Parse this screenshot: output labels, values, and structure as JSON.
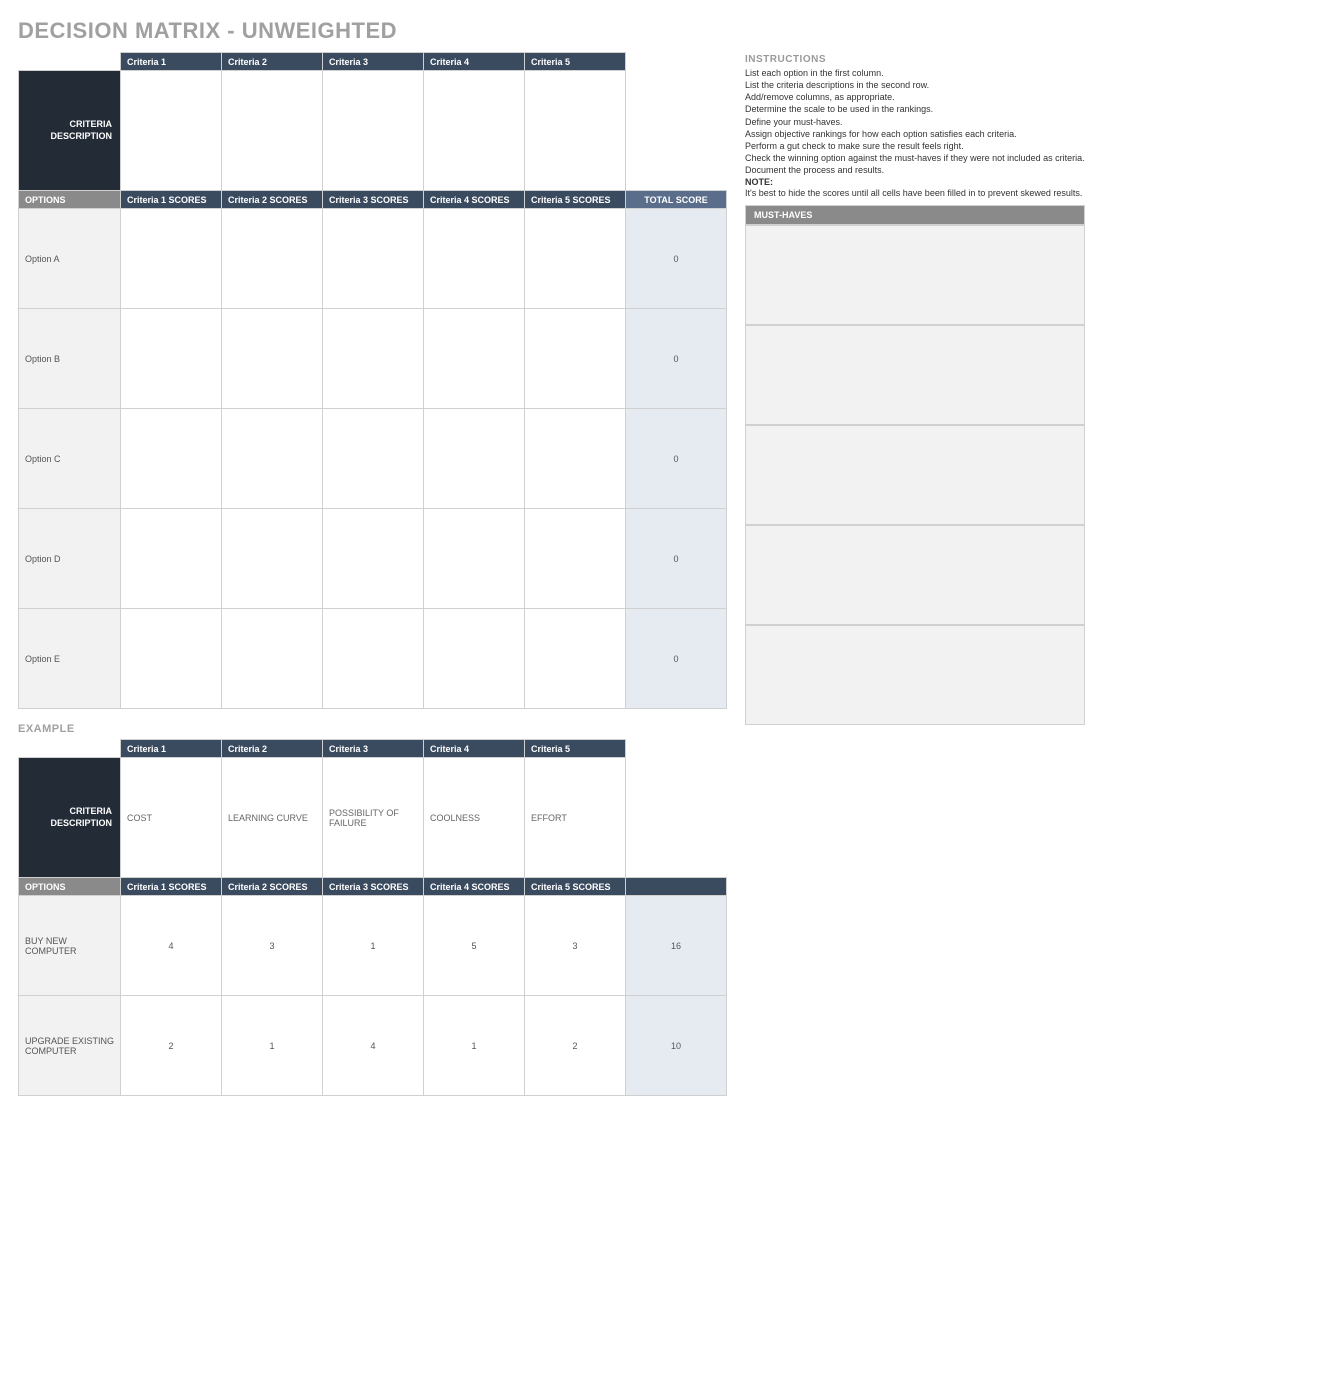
{
  "title": "DECISION MATRIX - UNWEIGHTED",
  "labels": {
    "criteria_description": "CRITERIA DESCRIPTION",
    "options": "OPTIONS",
    "total_score": "TOTAL SCORE",
    "must_haves": "MUST-HAVES",
    "example": "EXAMPLE"
  },
  "criteria_headers": [
    "Criteria 1",
    "Criteria 2",
    "Criteria 3",
    "Criteria 4",
    "Criteria 5"
  ],
  "score_headers": [
    "Criteria 1 SCORES",
    "Criteria 2 SCORES",
    "Criteria 3 SCORES",
    "Criteria 4 SCORES",
    "Criteria 5 SCORES"
  ],
  "descriptions": [
    "",
    "",
    "",
    "",
    ""
  ],
  "options": [
    {
      "name": "Option A",
      "scores": [
        "",
        "",
        "",
        "",
        ""
      ],
      "total": "0"
    },
    {
      "name": "Option B",
      "scores": [
        "",
        "",
        "",
        "",
        ""
      ],
      "total": "0"
    },
    {
      "name": "Option C",
      "scores": [
        "",
        "",
        "",
        "",
        ""
      ],
      "total": "0"
    },
    {
      "name": "Option D",
      "scores": [
        "",
        "",
        "",
        "",
        ""
      ],
      "total": "0"
    },
    {
      "name": "Option E",
      "scores": [
        "",
        "",
        "",
        "",
        ""
      ],
      "total": "0"
    }
  ],
  "instructions": {
    "title": "INSTRUCTIONS",
    "lines": [
      "List each option in the first column.",
      "List the criteria descriptions in the second row.",
      "Add/remove columns, as appropriate.",
      "Determine the scale to be used in the rankings.",
      "Define your must-haves.",
      "Assign objective rankings for how each option satisfies each criteria.",
      "Perform a gut check to make sure the result feels right.",
      "Check the winning option against the must-haves if they were not included as criteria.",
      "Document the process and results."
    ],
    "note_label": "NOTE:",
    "note_text": "It's best to hide the scores until all cells have been filled in to prevent skewed results."
  },
  "must_haves": [
    "",
    "",
    "",
    "",
    ""
  ],
  "example": {
    "criteria_headers": [
      "Criteria 1",
      "Criteria 2",
      "Criteria 3",
      "Criteria 4",
      "Criteria 5"
    ],
    "descriptions": [
      "COST",
      "LEARNING CURVE",
      "POSSIBILITY OF FAILURE",
      "COOLNESS",
      "EFFORT"
    ],
    "score_headers": [
      "Criteria 1 SCORES",
      "Criteria 2 SCORES",
      "Criteria 3 SCORES",
      "Criteria 4 SCORES",
      "Criteria 5 SCORES"
    ],
    "options": [
      {
        "name": "BUY NEW COMPUTER",
        "scores": [
          "4",
          "3",
          "1",
          "5",
          "3"
        ],
        "total": "16"
      },
      {
        "name": "UPGRADE EXISTING COMPUTER",
        "scores": [
          "2",
          "1",
          "4",
          "1",
          "2"
        ],
        "total": "10"
      }
    ]
  }
}
